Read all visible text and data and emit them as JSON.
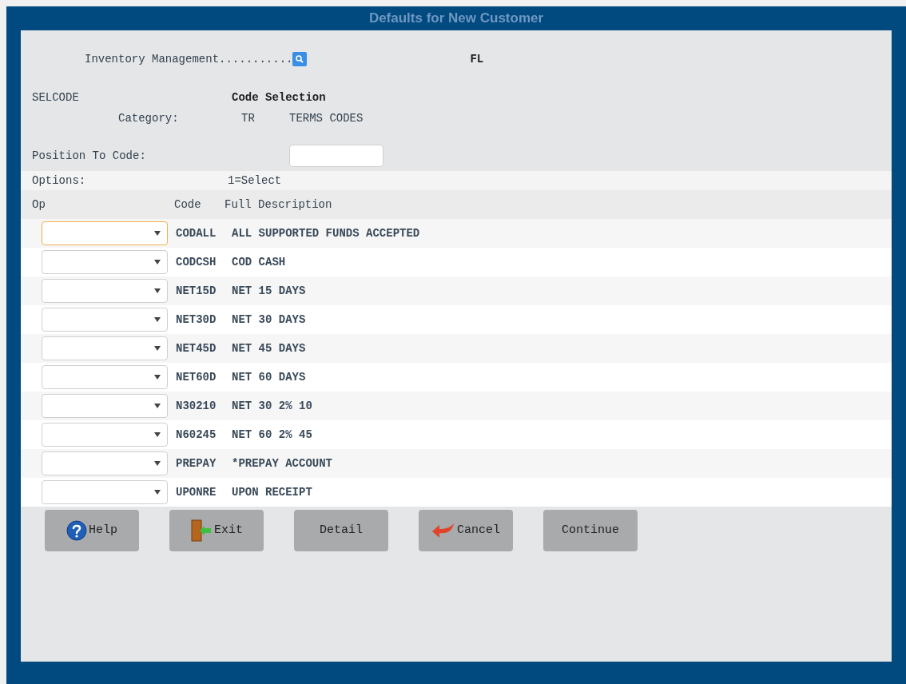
{
  "window": {
    "title": "Defaults for New Customer"
  },
  "header": {
    "module": "Inventory Management...........",
    "state": "FL",
    "program": "SELCODE",
    "screen_title": "Code Selection",
    "category_label": "Category:",
    "category_code": "TR",
    "category_name": "TERMS CODES"
  },
  "position_field": {
    "label": "Position To Code:"
  },
  "options": {
    "label": "Options:",
    "legend": "1=Select"
  },
  "table": {
    "columns": [
      "Op",
      "Code",
      "Full Description"
    ],
    "rows": [
      {
        "code": "CODALL",
        "description": "ALL SUPPORTED FUNDS ACCEPTED",
        "focused": true
      },
      {
        "code": "CODCSH",
        "description": "COD CASH",
        "focused": false
      },
      {
        "code": "NET15D",
        "description": "NET 15 DAYS",
        "focused": false
      },
      {
        "code": "NET30D",
        "description": "NET 30 DAYS",
        "focused": false
      },
      {
        "code": "NET45D",
        "description": "NET 45 DAYS",
        "focused": false
      },
      {
        "code": "NET60D",
        "description": "NET 60 DAYS",
        "focused": false
      },
      {
        "code": "N30210",
        "description": "NET 30 2% 10",
        "focused": false
      },
      {
        "code": "N60245",
        "description": "NET 60 2% 45",
        "focused": false
      },
      {
        "code": "PREPAY",
        "description": "*PREPAY ACCOUNT",
        "focused": false
      },
      {
        "code": "UPONRE",
        "description": "UPON RECEIPT",
        "focused": false
      }
    ]
  },
  "buttons": [
    {
      "label": "Help",
      "kind": "help"
    },
    {
      "label": "Exit",
      "kind": "exit"
    },
    {
      "label": "Detail",
      "kind": "plain"
    },
    {
      "label": "Cancel",
      "kind": "cancel"
    },
    {
      "label": "Continue",
      "kind": "plain"
    }
  ]
}
